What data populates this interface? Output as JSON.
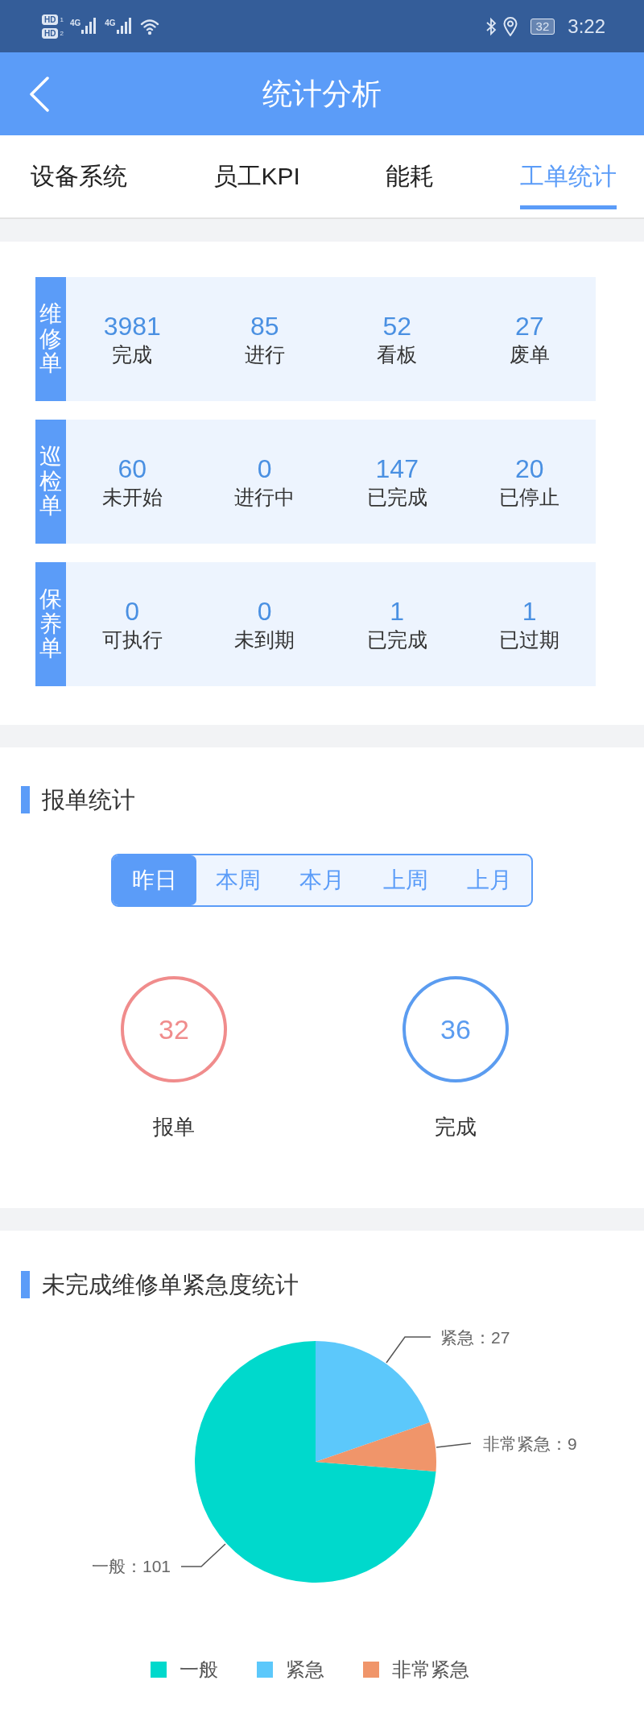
{
  "status_bar": {
    "sims": [
      {
        "hd": "HD",
        "slot": "1",
        "network": "4G"
      },
      {
        "hd": "HD",
        "slot": "2",
        "network": "4G"
      }
    ],
    "battery": "32",
    "time": "3:22"
  },
  "header": {
    "title": "统计分析"
  },
  "tabs": [
    {
      "label": "设备系统",
      "selected": false
    },
    {
      "label": "员工KPI",
      "selected": false
    },
    {
      "label": "能耗",
      "selected": false
    },
    {
      "label": "工单统计",
      "selected": true
    }
  ],
  "order_groups": [
    {
      "label": "维修单",
      "stats": [
        {
          "value": "3981",
          "label": "完成"
        },
        {
          "value": "85",
          "label": "进行"
        },
        {
          "value": "52",
          "label": "看板"
        },
        {
          "value": "27",
          "label": "废单"
        }
      ]
    },
    {
      "label": "巡检单",
      "stats": [
        {
          "value": "60",
          "label": "未开始"
        },
        {
          "value": "0",
          "label": "进行中"
        },
        {
          "value": "147",
          "label": "已完成"
        },
        {
          "value": "20",
          "label": "已停止"
        }
      ]
    },
    {
      "label": "保养单",
      "stats": [
        {
          "value": "0",
          "label": "可执行"
        },
        {
          "value": "0",
          "label": "未到期"
        },
        {
          "value": "1",
          "label": "已完成"
        },
        {
          "value": "1",
          "label": "已过期"
        }
      ]
    }
  ],
  "report_stats": {
    "title": "报单统计",
    "periods": [
      {
        "label": "昨日",
        "selected": true
      },
      {
        "label": "本周",
        "selected": false
      },
      {
        "label": "本月",
        "selected": false
      },
      {
        "label": "上周",
        "selected": false
      },
      {
        "label": "上月",
        "selected": false
      }
    ],
    "totals": [
      {
        "value": "32",
        "label": "报单",
        "color": "#f08c8c"
      },
      {
        "value": "36",
        "label": "完成",
        "color": "#5b9cf0"
      }
    ]
  },
  "urgency": {
    "title": "未完成维修单紧急度统计",
    "chart_data": {
      "type": "pie",
      "categories": [
        "一般",
        "紧急",
        "非常紧急"
      ],
      "values": [
        101,
        27,
        9
      ],
      "value_labels": [
        "一般：101",
        "紧急：27",
        "非常紧急：9"
      ]
    },
    "legend": [
      {
        "color": "#00d9cc"
      },
      {
        "color": "#5cc8fb"
      },
      {
        "color": "#f0956a"
      }
    ]
  }
}
